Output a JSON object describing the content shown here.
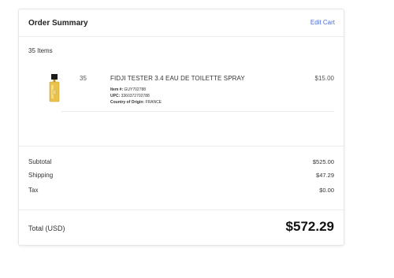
{
  "header": {
    "title": "Order Summary",
    "edit_cart": "Edit Cart"
  },
  "items_count": "35 Items",
  "item": {
    "quantity": "35",
    "name": "FIDJI TESTER 3.4 EAU DE TOILETTE SPRAY",
    "price": "$15.00",
    "item_no_label": "Item #:",
    "item_no": "GUY702788",
    "upc_label": "UPC:",
    "upc": "3360372702788",
    "origin_label": "Country of Origin:",
    "origin": "FRANCE",
    "image_icon": "perfume-bottle-icon"
  },
  "totals": {
    "subtotal_label": "Subtotal",
    "subtotal": "$525.00",
    "shipping_label": "Shipping",
    "shipping": "$47.29",
    "tax_label": "Tax",
    "tax": "$0.00",
    "total_label": "Total (USD)",
    "total": "$572.29"
  },
  "colors": {
    "link": "#4a6fd8",
    "border": "#ececec",
    "bottle_glass": "#e8c24a",
    "bottle_cap": "#1a1a1a"
  }
}
